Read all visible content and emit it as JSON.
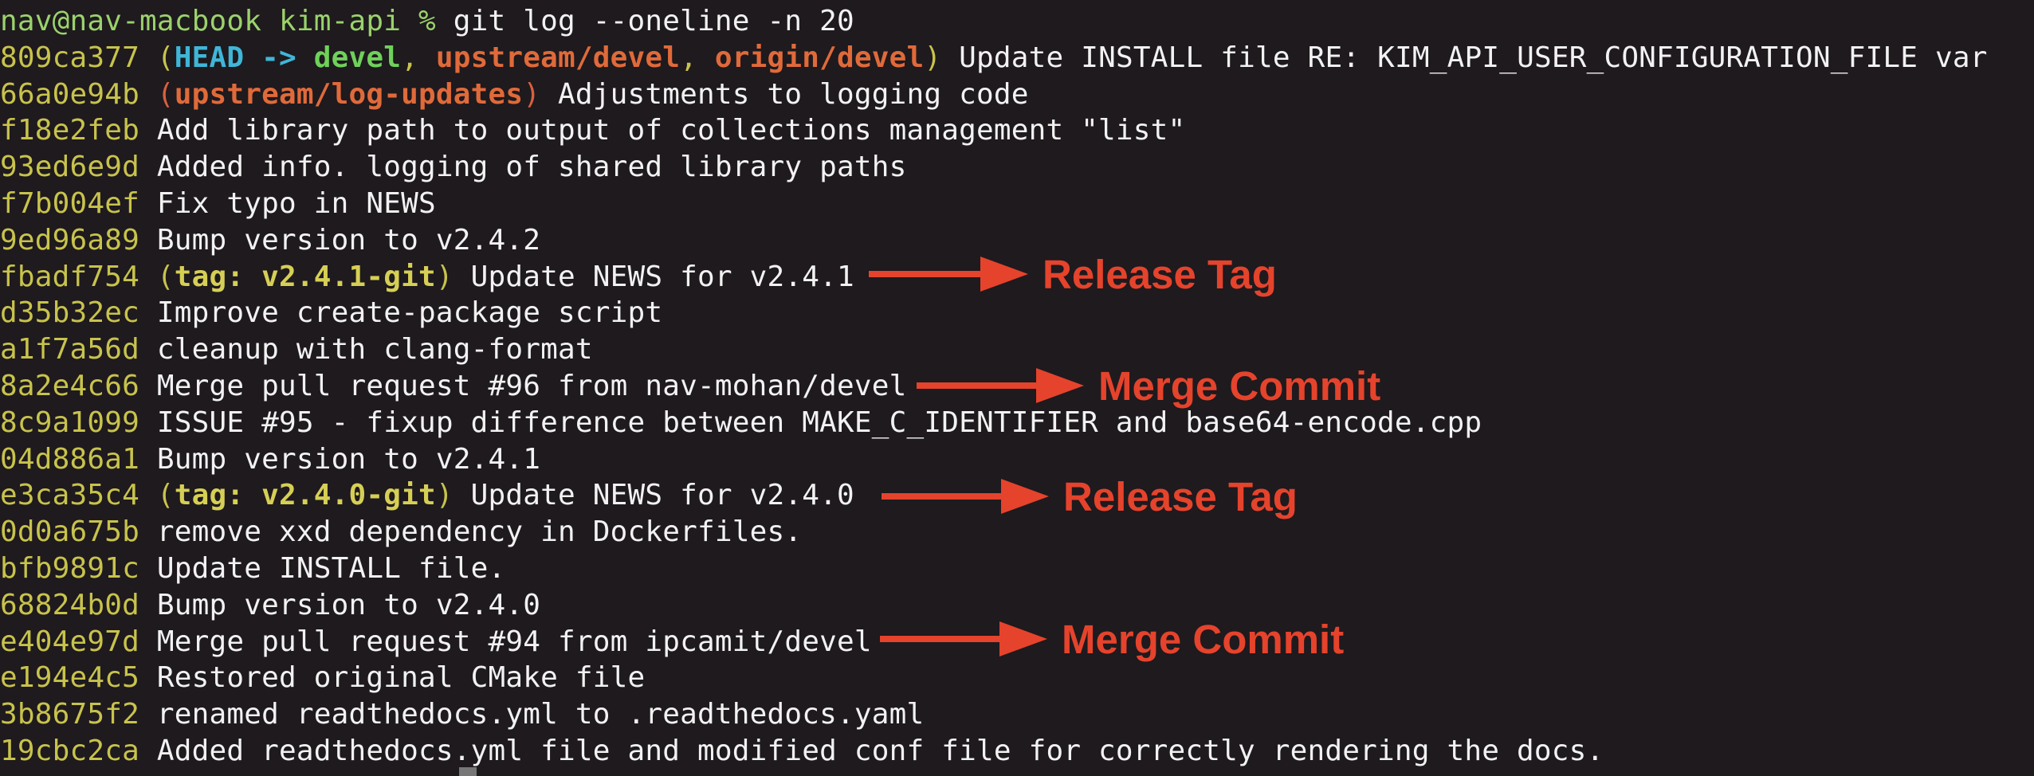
{
  "terminal": {
    "prompt": "nav@nav-macbook kim-api % ",
    "command": "git log --oneline -n 20"
  },
  "commits": [
    {
      "hash": "809ca377",
      "refs_open": "(",
      "head": "HEAD",
      "arrow": " -> ",
      "branch_local": "devel",
      "sep1": ", ",
      "branch_up": "upstream/devel",
      "sep2": ", ",
      "branch_origin": "origin/devel",
      "refs_close": ")",
      "message": " Update INSTALL file RE: KIM_API_USER_CONFIGURATION_FILE var"
    },
    {
      "hash": "66a0e94b",
      "refs_open": "(",
      "branch": "upstream/log-updates",
      "refs_close": ")",
      "message": " Adjustments to logging code"
    },
    {
      "hash": "f18e2feb",
      "message": " Add library path to output of collections management \"list\""
    },
    {
      "hash": "93ed6e9d",
      "message": " Added info. logging of shared library paths"
    },
    {
      "hash": "f7b004ef",
      "message": " Fix typo in NEWS"
    },
    {
      "hash": "9ed96a89",
      "message": " Bump version to v2.4.2"
    },
    {
      "hash": "fbadf754",
      "refs_open": "(",
      "tag": "tag: v2.4.1-git",
      "refs_close": ")",
      "message": " Update NEWS for v2.4.1"
    },
    {
      "hash": "d35b32ec",
      "message": " Improve create-package script"
    },
    {
      "hash": "a1f7a56d",
      "message": " cleanup with clang-format"
    },
    {
      "hash": "8a2e4c66",
      "message": " Merge pull request #96 from nav-mohan/devel"
    },
    {
      "hash": "8c9a1099",
      "message": " ISSUE #95 - fixup difference between MAKE_C_IDENTIFIER and base64-encode.cpp"
    },
    {
      "hash": "04d886a1",
      "message": " Bump version to v2.4.1"
    },
    {
      "hash": "e3ca35c4",
      "refs_open": "(",
      "tag": "tag: v2.4.0-git",
      "refs_close": ")",
      "message": " Update NEWS for v2.4.0"
    },
    {
      "hash": "0d0a675b",
      "message": " remove xxd dependency in Dockerfiles."
    },
    {
      "hash": "bfb9891c",
      "message": " Update INSTALL file."
    },
    {
      "hash": "68824b0d",
      "message": " Bump version to v2.4.0"
    },
    {
      "hash": "e404e97d",
      "message": " Merge pull request #94 from ipcamit/devel"
    },
    {
      "hash": "e194e4c5",
      "message": " Restored original CMake file"
    },
    {
      "hash": "3b8675f2",
      "message": " renamed readthedocs.yml to .readthedocs.yaml"
    },
    {
      "hash": "19cbc2ca",
      "message": " Added readthedocs.yml file and modified conf file for correctly rendering the docs."
    }
  ],
  "annotations": [
    {
      "label": "Release Tag",
      "row": 6
    },
    {
      "label": "Merge Commit",
      "row": 9
    },
    {
      "label": "Release Tag",
      "row": 12
    },
    {
      "label": "Merge Commit",
      "row": 16
    }
  ],
  "colors": {
    "background": "#1e1a1e",
    "prompt": "#9bd26c",
    "hash": "#c8c34c",
    "head": "#3fb6d8",
    "branch_local": "#6fd15a",
    "branch_remote": "#e06a3a",
    "tag": "#d6cf55",
    "annotation": "#e5432c"
  }
}
